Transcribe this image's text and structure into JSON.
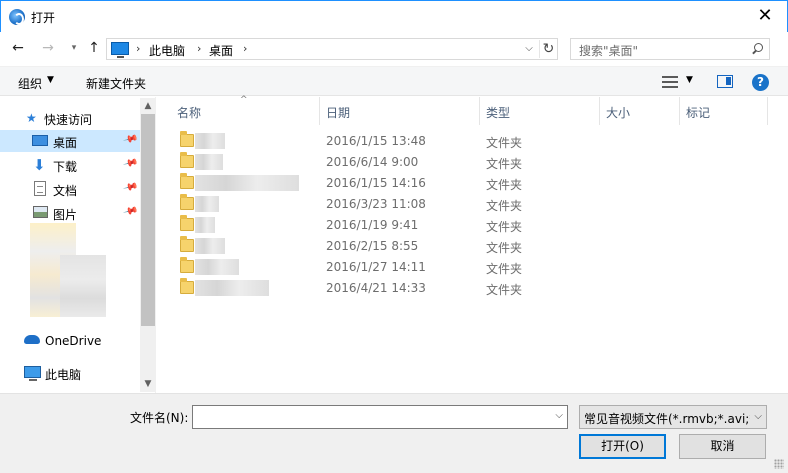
{
  "window": {
    "title": "打开",
    "close_glyph": "✕"
  },
  "nav": {
    "back_glyph": "←",
    "forward_glyph": "→",
    "recent_glyph": "▾",
    "up_glyph": "↑",
    "breadcrumbs": [
      "此电脑",
      "桌面"
    ],
    "sep_glyph": "›",
    "dropdown_glyph": "⌵",
    "refresh_glyph": "↻"
  },
  "search": {
    "placeholder": "搜索\"桌面\""
  },
  "toolbar": {
    "organize": "组织",
    "organize_arrow": "▼",
    "new_folder": "新建文件夹",
    "view_arrow": "▼",
    "help": "?"
  },
  "sidebar": {
    "items": [
      {
        "label": "快速访问"
      },
      {
        "label": "桌面"
      },
      {
        "label": "下载"
      },
      {
        "label": "文档"
      },
      {
        "label": "图片"
      },
      {
        "label": "OneDrive"
      },
      {
        "label": "此电脑"
      }
    ],
    "pin_glyph": "📌",
    "scroll_up": "▲",
    "scroll_down": "▼"
  },
  "columns": [
    {
      "label": "名称"
    },
    {
      "label": "日期"
    },
    {
      "label": "类型"
    },
    {
      "label": "大小"
    },
    {
      "label": "标记"
    }
  ],
  "sort_glyph": "^",
  "files": [
    {
      "date": "2016/1/15 13:48",
      "type": "文件夹"
    },
    {
      "date": "2016/6/14 9:00",
      "type": "文件夹"
    },
    {
      "date": "2016/1/15 14:16",
      "type": "文件夹"
    },
    {
      "date": "2016/3/23 11:08",
      "type": "文件夹"
    },
    {
      "date": "2016/1/19 9:41",
      "type": "文件夹"
    },
    {
      "date": "2016/2/15 8:55",
      "type": "文件夹"
    },
    {
      "date": "2016/1/27 14:11",
      "type": "文件夹"
    },
    {
      "date": "2016/4/21 14:33",
      "type": "文件夹"
    }
  ],
  "bottom": {
    "filename_label": "文件名(N):",
    "filename_value": "",
    "filter_label": "常见音视频文件(*.rmvb;*.avi;*.",
    "filter_arrow": "⌵",
    "open_button": "打开(O)",
    "cancel_button": "取消"
  },
  "colors": {
    "accent": "#0078d7",
    "selected": "#cce8ff",
    "folder": "#f6d36c"
  }
}
